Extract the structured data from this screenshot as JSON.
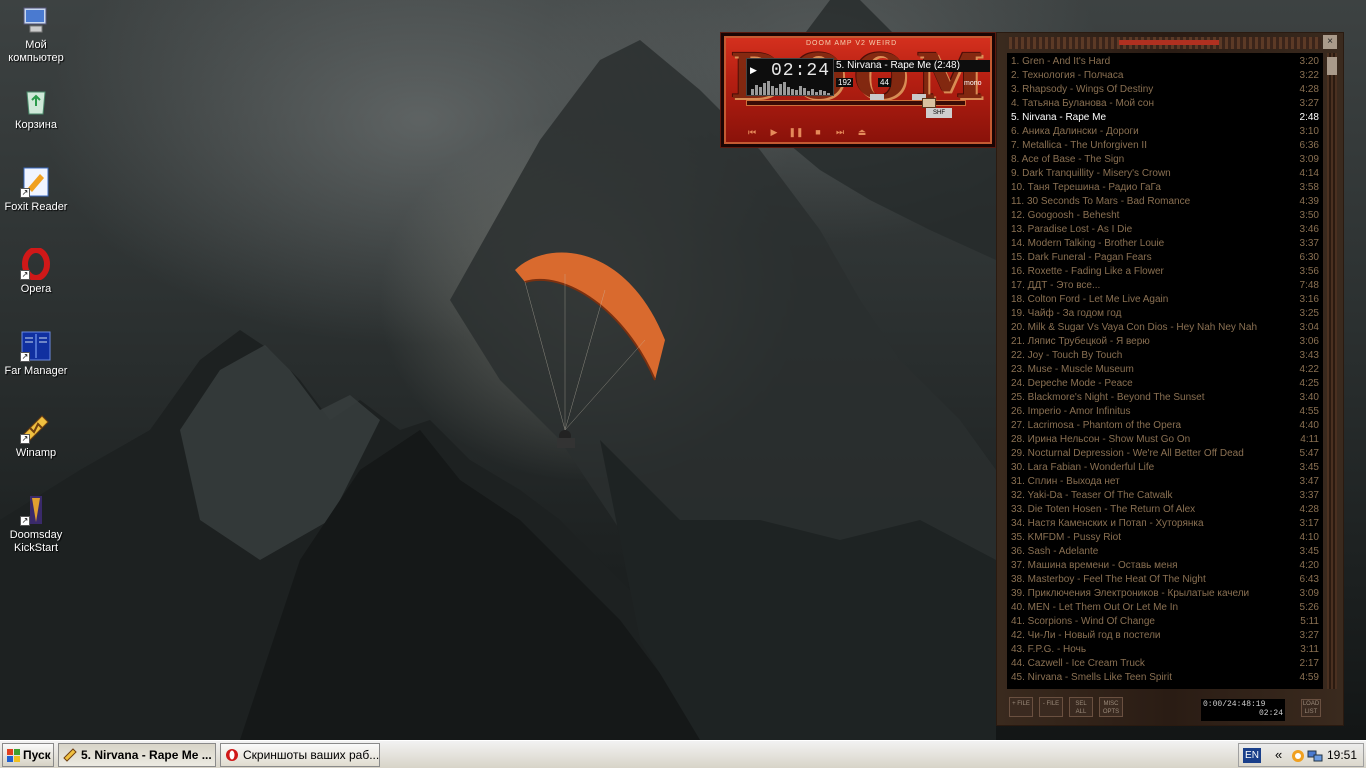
{
  "desktop": {
    "icons": [
      {
        "label": "Мой компьютер",
        "icon": "my-computer-icon"
      },
      {
        "label": "Корзина",
        "icon": "recycle-bin-icon"
      },
      {
        "label": "Foxit Reader",
        "icon": "foxit-reader-icon"
      },
      {
        "label": "Opera",
        "icon": "opera-icon"
      },
      {
        "label": "Far Manager",
        "icon": "far-manager-icon"
      },
      {
        "label": "Winamp",
        "icon": "winamp-icon"
      },
      {
        "label": "Doomsday KickStart",
        "icon": "doomsday-icon"
      }
    ]
  },
  "winamp": {
    "skin_title": "DOOM AMP V2 WEIRD",
    "time": "02:24",
    "ticker": "5. Nirvana - Rape Me (2:48)",
    "kbps": "192",
    "khz": "44",
    "mono": "mono",
    "seek_fraction": 0.86,
    "transport": [
      "prev",
      "play",
      "pause",
      "stop",
      "next",
      "eject"
    ]
  },
  "playlist": {
    "current_index": 4,
    "items": [
      {
        "title": "1. Gren - And It's Hard",
        "duration": "3:20"
      },
      {
        "title": "2. Технология - Полчаса",
        "duration": "3:22"
      },
      {
        "title": "3. Rhapsody - Wings Of Destiny",
        "duration": "4:28"
      },
      {
        "title": "4. Татьяна Буланова - Мой сон",
        "duration": "3:27"
      },
      {
        "title": "5. Nirvana - Rape Me",
        "duration": "2:48"
      },
      {
        "title": "6. Аника Далински - Дороги",
        "duration": "3:10"
      },
      {
        "title": "7. Metallica - The Unforgiven II",
        "duration": "6:36"
      },
      {
        "title": "8. Ace of Base - The Sign",
        "duration": "3:09"
      },
      {
        "title": "9. Dark Tranquillity - Misery's Crown",
        "duration": "4:14"
      },
      {
        "title": "10. Таня Терешина - Радио ГаГа",
        "duration": "3:58"
      },
      {
        "title": "11. 30 Seconds To Mars - Bad Romance",
        "duration": "4:39"
      },
      {
        "title": "12. Googoosh - Behesht",
        "duration": "3:50"
      },
      {
        "title": "13. Paradise Lost - As I Die",
        "duration": "3:46"
      },
      {
        "title": "14. Modern Talking - Brother Louie",
        "duration": "3:37"
      },
      {
        "title": "15. Dark Funeral - Pagan Fears",
        "duration": "6:30"
      },
      {
        "title": "16. Roxette - Fading Like a Flower",
        "duration": "3:56"
      },
      {
        "title": "17. ДДТ - Это все...",
        "duration": "7:48"
      },
      {
        "title": "18. Colton Ford - Let Me Live Again",
        "duration": "3:16"
      },
      {
        "title": "19. Чайф - За годом год",
        "duration": "3:25"
      },
      {
        "title": "20. Milk & Sugar Vs Vaya Con Dios - Hey Nah Ney Nah",
        "duration": "3:04"
      },
      {
        "title": "21. Ляпис Трубецкой - Я верю",
        "duration": "3:06"
      },
      {
        "title": "22. Joy - Touch By Touch",
        "duration": "3:43"
      },
      {
        "title": "23. Muse - Muscle Museum",
        "duration": "4:22"
      },
      {
        "title": "24. Depeche Mode - Peace",
        "duration": "4:25"
      },
      {
        "title": "25. Blackmore's Night - Beyond The Sunset",
        "duration": "3:40"
      },
      {
        "title": "26. Imperio - Amor Infinitus",
        "duration": "4:55"
      },
      {
        "title": "27. Lacrimosa - Phantom of the Opera",
        "duration": "4:40"
      },
      {
        "title": "28. Ирина Нельсон - Show Must Go On",
        "duration": "4:11"
      },
      {
        "title": "29. Nocturnal Depression - We're All Better Off Dead",
        "duration": "5:47"
      },
      {
        "title": "30. Lara Fabian - Wonderful Life",
        "duration": "3:45"
      },
      {
        "title": "31. Сплин - Выхода нет",
        "duration": "3:47"
      },
      {
        "title": "32. Yaki-Da - Teaser Of The Catwalk",
        "duration": "3:37"
      },
      {
        "title": "33. Die Toten Hosen - The Return Of Alex",
        "duration": "4:28"
      },
      {
        "title": "34. Настя Каменских и Потап - Хуторянка",
        "duration": "3:17"
      },
      {
        "title": "35. KMFDM - Pussy Riot",
        "duration": "4:10"
      },
      {
        "title": "36. Sash - Adelante",
        "duration": "3:45"
      },
      {
        "title": "37. Машина времени - Оставь меня",
        "duration": "4:20"
      },
      {
        "title": "38. Masterboy - Feel The Heat Of The Night",
        "duration": "6:43"
      },
      {
        "title": "39. Приключения Электроников - Крылатые качели",
        "duration": "3:09"
      },
      {
        "title": "40. MEN - Let Them Out Or Let Me In",
        "duration": "5:26"
      },
      {
        "title": "41. Scorpions - Wind Of Change",
        "duration": "5:11"
      },
      {
        "title": "42. Чи-Ли - Новый год в постели",
        "duration": "3:27"
      },
      {
        "title": "43. F.P.G. - Ночь",
        "duration": "3:11"
      },
      {
        "title": "44. Cazwell - Ice Cream Truck",
        "duration": "2:17"
      },
      {
        "title": "45. Nirvana - Smells Like Teen Spirit",
        "duration": "4:59"
      }
    ],
    "buttons": [
      "+ FILE",
      "- FILE",
      "SEL ALL",
      "MISC OPTS"
    ],
    "total_time": "0:00/24:48:19",
    "mini_time": "02:24",
    "list_button": "LOAD LIST"
  },
  "taskbar": {
    "start_label": "Пуск",
    "tasks": [
      {
        "label": "5. Nirvana - Rape Me ...",
        "icon": "winamp-icon",
        "active": true
      },
      {
        "label": "Скриншоты ваших раб...",
        "icon": "opera-icon",
        "active": false
      }
    ],
    "lang": "EN",
    "clock": "19:51"
  }
}
